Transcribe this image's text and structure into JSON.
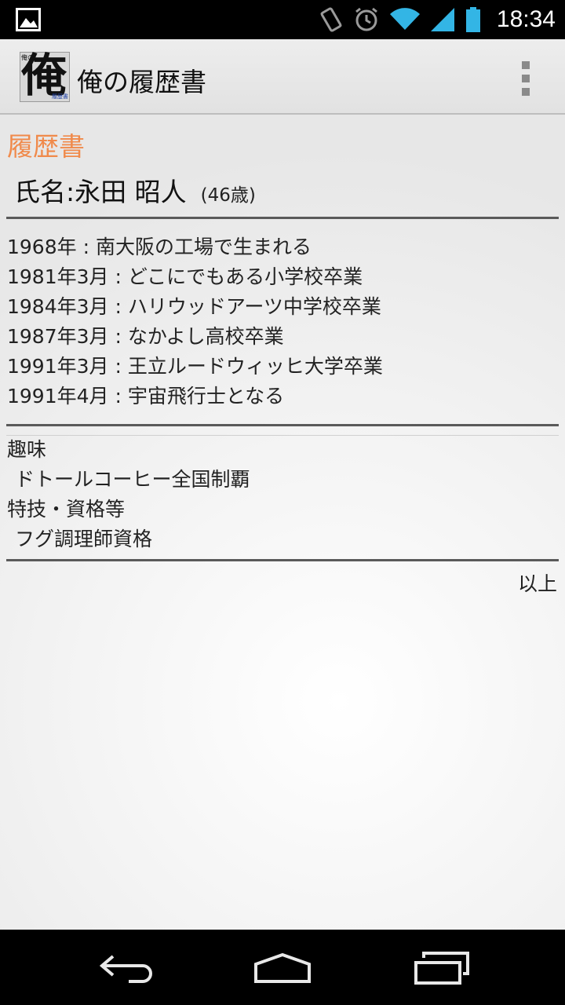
{
  "status_bar": {
    "time": "18:34",
    "icons": [
      "gallery-notification-icon",
      "vibrate-icon",
      "alarm-icon",
      "wifi-icon",
      "signal-icon",
      "battery-icon"
    ],
    "accent_color": "#33b5e5"
  },
  "action_bar": {
    "app_name": "俺の履歴書",
    "icon": {
      "main_glyph": "俺",
      "small_top_text": "俺の",
      "small_bottom_text": "履歴書"
    },
    "overflow_icon": "overflow-menu-icon"
  },
  "resume": {
    "section_title": "履歴書",
    "section_title_color": "#f08a4b",
    "name": "氏名:永田 昭人",
    "age": "(46歳)",
    "history": [
      "1968年 : 南大阪の工場で生まれる",
      "1981年3月 : どこにでもある小学校卒業",
      "1984年3月 : ハリウッドアーツ中学校卒業",
      "1987年3月 : なかよし高校卒業",
      "1991年3月 : 王立ルードウィッヒ大学卒業",
      "1991年4月 : 宇宙飛行士となる"
    ],
    "hobby_label": "趣味",
    "hobby_value": "ドトールコーヒー全国制覇",
    "skills_label": "特技・資格等",
    "skills_value": "フグ調理師資格",
    "closing": "以上"
  },
  "nav_bar": {
    "buttons": [
      "back-icon",
      "home-icon",
      "recent-apps-icon"
    ]
  }
}
